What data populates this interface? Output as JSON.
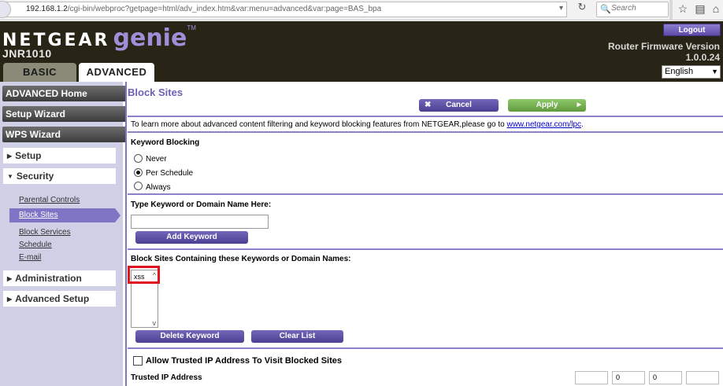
{
  "browser": {
    "url_host": "192.168.1.2",
    "url_path": "/cgi-bin/webproc?getpage=html/adv_index.htm&var:menu=advanced&var:page=BAS_bpa",
    "search_placeholder": "Search"
  },
  "header": {
    "brand": "NETGEAR",
    "product": "genie",
    "trademark": "TM",
    "model": "JNR1010",
    "logout_label": "Logout",
    "firmware_label": "Router Firmware Version",
    "firmware_version": "1.0.0.24",
    "language": "English",
    "tabs": [
      {
        "label": "BASIC"
      },
      {
        "label": "ADVANCED"
      }
    ]
  },
  "sidebar": {
    "advanced_home": "ADVANCED Home",
    "setup_wizard": "Setup Wizard",
    "wps_wizard": "WPS Wizard",
    "setup": "Setup",
    "security": "Security",
    "security_items": [
      {
        "label": "Parental Controls"
      },
      {
        "label": "Block Sites"
      },
      {
        "label": "Block Services"
      },
      {
        "label": "Schedule"
      },
      {
        "label": "E-mail"
      }
    ],
    "administration": "Administration",
    "advanced_setup": "Advanced Setup"
  },
  "main": {
    "title": "Block Sites",
    "cancel_label": "Cancel",
    "apply_label": "Apply",
    "info_text": "To learn more about advanced content filtering and keyword blocking features from NETGEAR,please go to",
    "info_link": "www.netgear.com/lpc",
    "info_period": ".",
    "keyword_blocking_label": "Keyword Blocking",
    "options": [
      {
        "label": "Never",
        "selected": false
      },
      {
        "label": "Per Schedule",
        "selected": true
      },
      {
        "label": "Always",
        "selected": false
      }
    ],
    "type_keyword_label": "Type Keyword or Domain Name Here:",
    "keyword_input_value": "",
    "add_keyword_label": "Add Keyword",
    "block_list_label": "Block Sites Containing these Keywords or Domain Names:",
    "blocked_keywords": [
      "xss"
    ],
    "delete_keyword_label": "Delete Keyword",
    "clear_list_label": "Clear List",
    "allow_trusted_label": "Allow Trusted IP Address To Visit Blocked Sites",
    "allow_trusted_checked": false,
    "trusted_ip_label": "Trusted IP Address",
    "trusted_ip": [
      "",
      "0",
      "0",
      ""
    ]
  },
  "colors": {
    "header_bg": "#282516",
    "accent_purple": "#7e76c4",
    "sidebar_bg": "#cfcfe6",
    "apply_green": "#7bb654",
    "highlight_red": "#e0141e"
  }
}
